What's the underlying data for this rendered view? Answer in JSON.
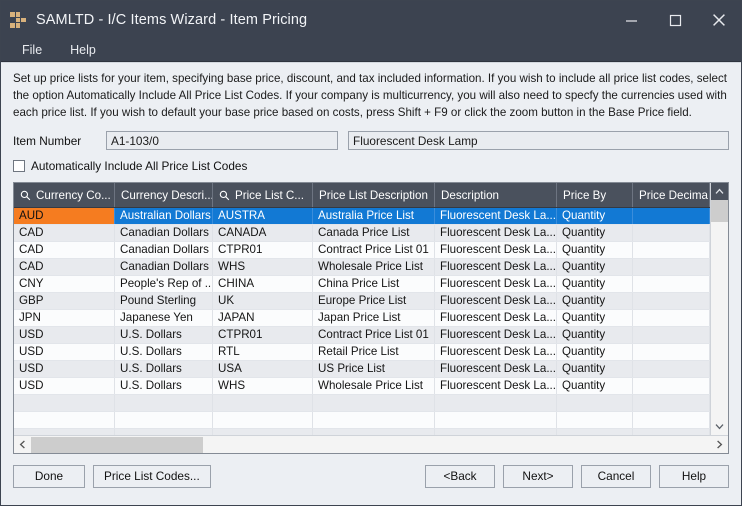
{
  "window": {
    "title": "SAMLTD - I/C Items Wizard - Item Pricing",
    "app_icon": "grid-squares-icon",
    "minimize_label": "Minimize",
    "maximize_label": "Maximize",
    "close_label": "Close",
    "accent_selection": "#1279d4",
    "accent_anchor": "#f57c20",
    "titlebar_color": "#3c4350"
  },
  "menu": {
    "items": [
      {
        "label": "File"
      },
      {
        "label": "Help"
      }
    ]
  },
  "instructions": {
    "text": "Set up price lists for your item, specifying base price, discount, and tax included information. If you wish to include all price list codes, select the option Automatically Include All Price List Codes. If your company is multicurrency, you will also need to specfy the currencies used with each price list. If you wish to default your base price based on costs, press Shift + F9 or click the zoom button in the Base Price field."
  },
  "item": {
    "label": "Item Number",
    "number_value": "A1-103/0",
    "number_placeholder": "",
    "description_value": "Fluorescent Desk Lamp",
    "description_placeholder": ""
  },
  "options": {
    "auto_include_label": "Automatically Include All Price List Codes",
    "auto_include_checked": false
  },
  "grid": {
    "columns": [
      {
        "label": "Currency Co...",
        "icon": "magnifier-icon",
        "has_icon": true
      },
      {
        "label": "Currency Descri...",
        "icon": "",
        "has_icon": false
      },
      {
        "label": "Price List C...",
        "icon": "magnifier-icon",
        "has_icon": true
      },
      {
        "label": "Price List Description",
        "icon": "",
        "has_icon": false
      },
      {
        "label": "Description",
        "icon": "",
        "has_icon": false
      },
      {
        "label": "Price By",
        "icon": "",
        "has_icon": false
      },
      {
        "label": "Price Decima",
        "icon": "",
        "has_icon": false
      }
    ],
    "rows": [
      {
        "currency_code": "AUD",
        "currency_description": "Australian Dollars",
        "price_list_code": "AUSTRA",
        "price_list_description": "Australia Price List",
        "description": "Fluorescent Desk La...",
        "price_by": "Quantity",
        "price_decimals": "",
        "selected": true
      },
      {
        "currency_code": "CAD",
        "currency_description": "Canadian Dollars",
        "price_list_code": "CANADA",
        "price_list_description": "Canada Price List",
        "description": "Fluorescent Desk La...",
        "price_by": "Quantity",
        "price_decimals": "",
        "selected": false
      },
      {
        "currency_code": "CAD",
        "currency_description": "Canadian Dollars",
        "price_list_code": "CTPR01",
        "price_list_description": "Contract Price List 01",
        "description": "Fluorescent Desk La...",
        "price_by": "Quantity",
        "price_decimals": "",
        "selected": false
      },
      {
        "currency_code": "CAD",
        "currency_description": "Canadian Dollars",
        "price_list_code": "WHS",
        "price_list_description": "Wholesale Price List",
        "description": "Fluorescent Desk La...",
        "price_by": "Quantity",
        "price_decimals": "",
        "selected": false
      },
      {
        "currency_code": "CNY",
        "currency_description": "People's Rep of ...",
        "price_list_code": "CHINA",
        "price_list_description": "China Price List",
        "description": "Fluorescent Desk La...",
        "price_by": "Quantity",
        "price_decimals": "",
        "selected": false
      },
      {
        "currency_code": "GBP",
        "currency_description": "Pound Sterling",
        "price_list_code": "UK",
        "price_list_description": "Europe Price List",
        "description": "Fluorescent Desk La...",
        "price_by": "Quantity",
        "price_decimals": "",
        "selected": false
      },
      {
        "currency_code": "JPN",
        "currency_description": "Japanese Yen",
        "price_list_code": "JAPAN",
        "price_list_description": "Japan Price List",
        "description": "Fluorescent Desk La...",
        "price_by": "Quantity",
        "price_decimals": "",
        "selected": false
      },
      {
        "currency_code": "USD",
        "currency_description": "U.S. Dollars",
        "price_list_code": "CTPR01",
        "price_list_description": "Contract Price List 01",
        "description": "Fluorescent Desk La...",
        "price_by": "Quantity",
        "price_decimals": "",
        "selected": false
      },
      {
        "currency_code": "USD",
        "currency_description": "U.S. Dollars",
        "price_list_code": "RTL",
        "price_list_description": "Retail Price List",
        "description": "Fluorescent Desk La...",
        "price_by": "Quantity",
        "price_decimals": "",
        "selected": false
      },
      {
        "currency_code": "USD",
        "currency_description": "U.S. Dollars",
        "price_list_code": "USA",
        "price_list_description": "US Price List",
        "description": "Fluorescent Desk La...",
        "price_by": "Quantity",
        "price_decimals": "",
        "selected": false
      },
      {
        "currency_code": "USD",
        "currency_description": "U.S. Dollars",
        "price_list_code": "WHS",
        "price_list_description": "Wholesale Price List",
        "description": "Fluorescent Desk La...",
        "price_by": "Quantity",
        "price_decimals": "",
        "selected": false
      },
      {
        "currency_code": "",
        "currency_description": "",
        "price_list_code": "",
        "price_list_description": "",
        "description": "",
        "price_by": "",
        "price_decimals": "",
        "selected": false
      },
      {
        "currency_code": "",
        "currency_description": "",
        "price_list_code": "",
        "price_list_description": "",
        "description": "",
        "price_by": "",
        "price_decimals": "",
        "selected": false
      },
      {
        "currency_code": "",
        "currency_description": "",
        "price_list_code": "",
        "price_list_description": "",
        "description": "",
        "price_by": "",
        "price_decimals": "",
        "selected": false
      }
    ]
  },
  "footer": {
    "done_label": "Done",
    "price_list_codes_label": "Price List Codes...",
    "back_label": "<Back",
    "next_label": "Next>",
    "cancel_label": "Cancel",
    "help_label": "Help"
  }
}
